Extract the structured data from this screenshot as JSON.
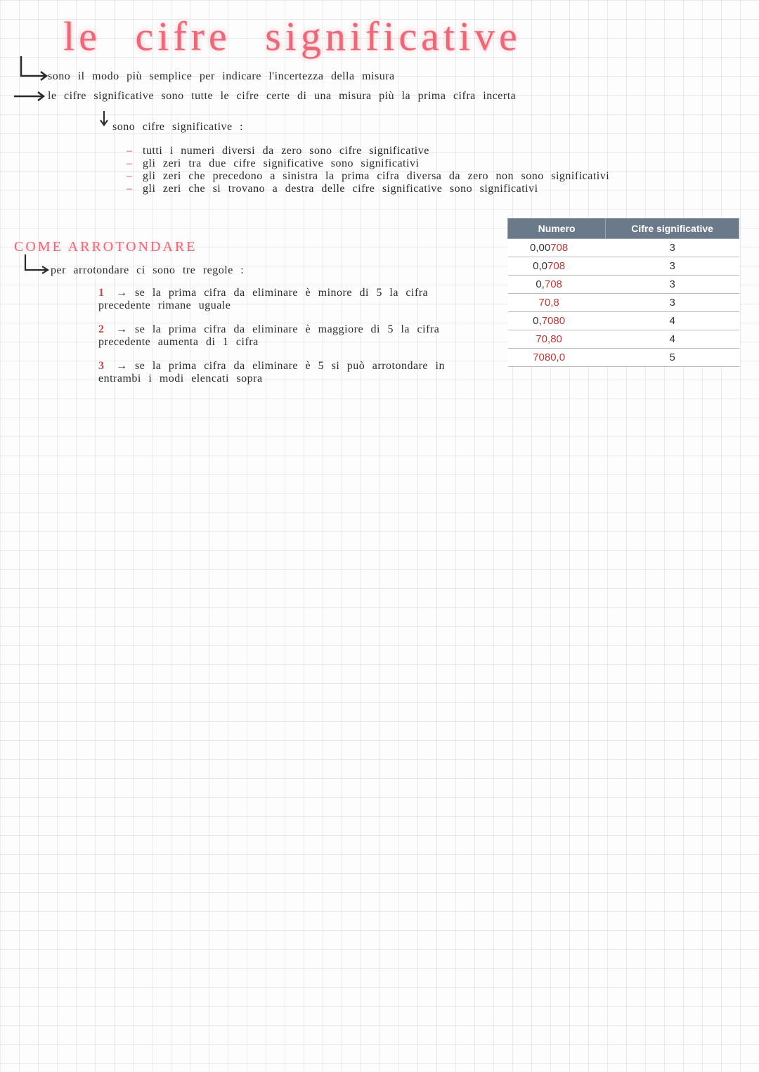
{
  "title": "le cifre significative",
  "intro": {
    "line1": "sono il modo più semplice per indicare l'incertezza della misura",
    "line2": "le cifre significative sono tutte le cifre certe di una misura più la prima cifra incerta"
  },
  "rules_heading": "sono cifre significative :",
  "rules": [
    "tutti i numeri diversi da zero sono cifre significative",
    "gli zeri tra due cifre significative sono significativi",
    "gli zeri che precedono a sinistra la prima cifra diversa da zero non sono significativi",
    "gli zeri che si trovano a destra delle cifre significative sono significativi"
  ],
  "sub_heading": "COME ARROTONDARE",
  "round_intro": "per arrotondare ci sono tre regole :",
  "round_rules": [
    {
      "n": "1",
      "text": "se la prima cifra da eliminare è minore di 5 la cifra precedente rimane uguale"
    },
    {
      "n": "2",
      "text": "se la prima cifra da eliminare è maggiore di 5 la cifra precedente aumenta di 1 cifra"
    },
    {
      "n": "3",
      "text": "se la prima cifra da eliminare è 5 si può arrotondare in entrambi i modi elencati sopra"
    }
  ],
  "chart_data": {
    "type": "table",
    "title": "",
    "columns": [
      "Numero",
      "Cifre significative"
    ],
    "rows": [
      {
        "numero_pre": "0,00",
        "numero_sig": "708",
        "numero_post": "",
        "cifre": "3"
      },
      {
        "numero_pre": "0,0",
        "numero_sig": "708",
        "numero_post": "",
        "cifre": "3"
      },
      {
        "numero_pre": "0,",
        "numero_sig": "708",
        "numero_post": "",
        "cifre": "3"
      },
      {
        "numero_pre": "",
        "numero_sig": "70,8",
        "numero_post": "",
        "cifre": "3"
      },
      {
        "numero_pre": "0,",
        "numero_sig": "7080",
        "numero_post": "",
        "cifre": "4"
      },
      {
        "numero_pre": "",
        "numero_sig": "70,80",
        "numero_post": "",
        "cifre": "4"
      },
      {
        "numero_pre": "",
        "numero_sig": "7080,0",
        "numero_post": "",
        "cifre": "5"
      }
    ]
  }
}
